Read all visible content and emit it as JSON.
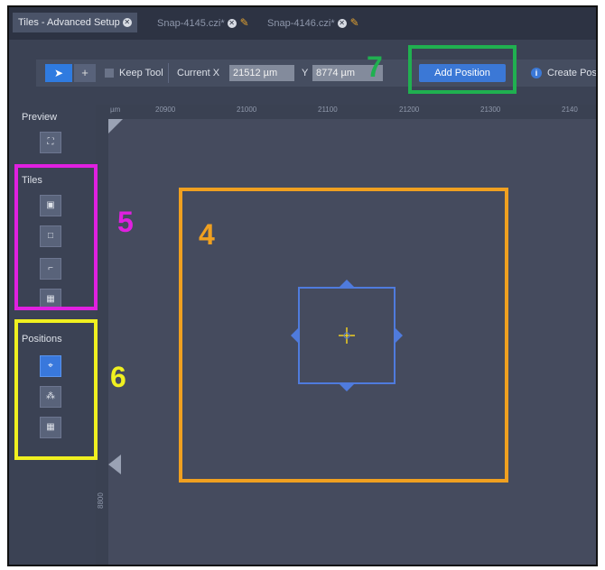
{
  "tabs": [
    {
      "label": "Tiles - Advanced Setup",
      "active": true
    },
    {
      "label": "Snap-4145.czi*",
      "active": false
    },
    {
      "label": "Snap-4146.czi*",
      "active": false
    }
  ],
  "toolbar": {
    "pointer_icon": "pointer-icon",
    "plus_icon": "plus-icon",
    "keep_tool_label": "Keep Tool",
    "current_x_label": "Current X",
    "current_x_value": "21512 µm",
    "y_label": "Y",
    "y_value": "8774 µm",
    "add_position_label": "Add Position",
    "create_pos_label": "Create Pos"
  },
  "sidebar": {
    "preview_label": "Preview",
    "tiles_label": "Tiles",
    "positions_label": "Positions"
  },
  "ruler": {
    "unit": "µm",
    "ticks": [
      "20900",
      "21000",
      "21100",
      "21200",
      "21300",
      "2140"
    ],
    "vertical_label": "8800"
  },
  "annotations": [
    {
      "number": "4",
      "color": "#f0a020"
    },
    {
      "number": "5",
      "color": "#e020e0"
    },
    {
      "number": "6",
      "color": "#f0f020"
    },
    {
      "number": "7",
      "color": "#20b050"
    }
  ],
  "colors": {
    "accent": "#3b78d6",
    "background": "#3e4557"
  }
}
